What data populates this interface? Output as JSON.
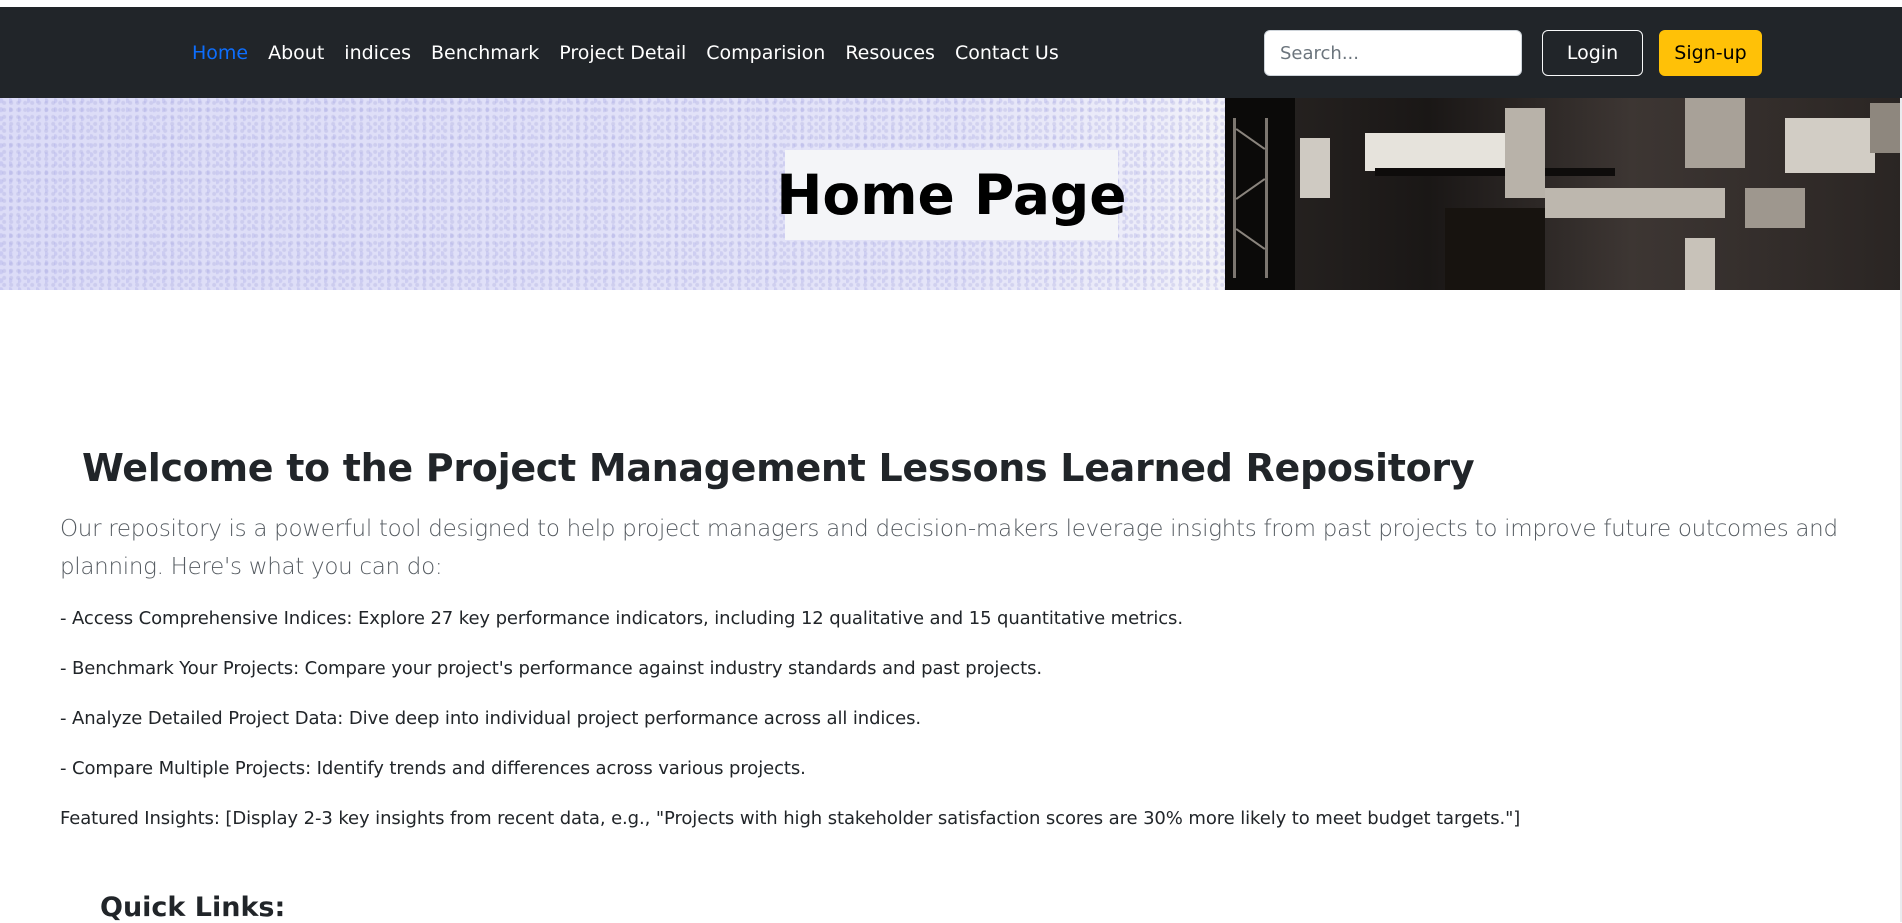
{
  "nav": {
    "links": [
      "Home",
      "About",
      "indices",
      "Benchmark",
      "Project Detail",
      "Comparision",
      "Resouces",
      "Contact Us"
    ],
    "active_index": 0,
    "search_placeholder": "Search...",
    "login_label": "Login",
    "signup_label": "Sign-up"
  },
  "hero": {
    "title": "Home Page"
  },
  "main": {
    "heading": "Welcome to the Project Management Lessons Learned Repository",
    "lead": "Our repository is a powerful tool designed to help project managers and decision-makers leverage insights from past projects to improve future outcomes and planning. Here's what you can do:",
    "bullets": [
      "- Access Comprehensive Indices: Explore 27 key performance indicators, including 12 qualitative and 15 quantitative metrics.",
      "- Benchmark Your Projects: Compare your project's performance against industry standards and past projects.",
      "- Analyze Detailed Project Data: Dive deep into individual project performance across all indices.",
      "- Compare Multiple Projects: Identify trends and differences across various projects."
    ],
    "featured": "Featured Insights: [Display 2-3 key insights from recent data, e.g., \"Projects with high stakeholder satisfaction scores are 30% more likely to meet budget targets.\"]",
    "quick_links_heading": "Quick Links:"
  },
  "colors": {
    "navbar_bg": "#212529",
    "active_link": "#0d6efd",
    "signup_bg": "#ffc107"
  }
}
